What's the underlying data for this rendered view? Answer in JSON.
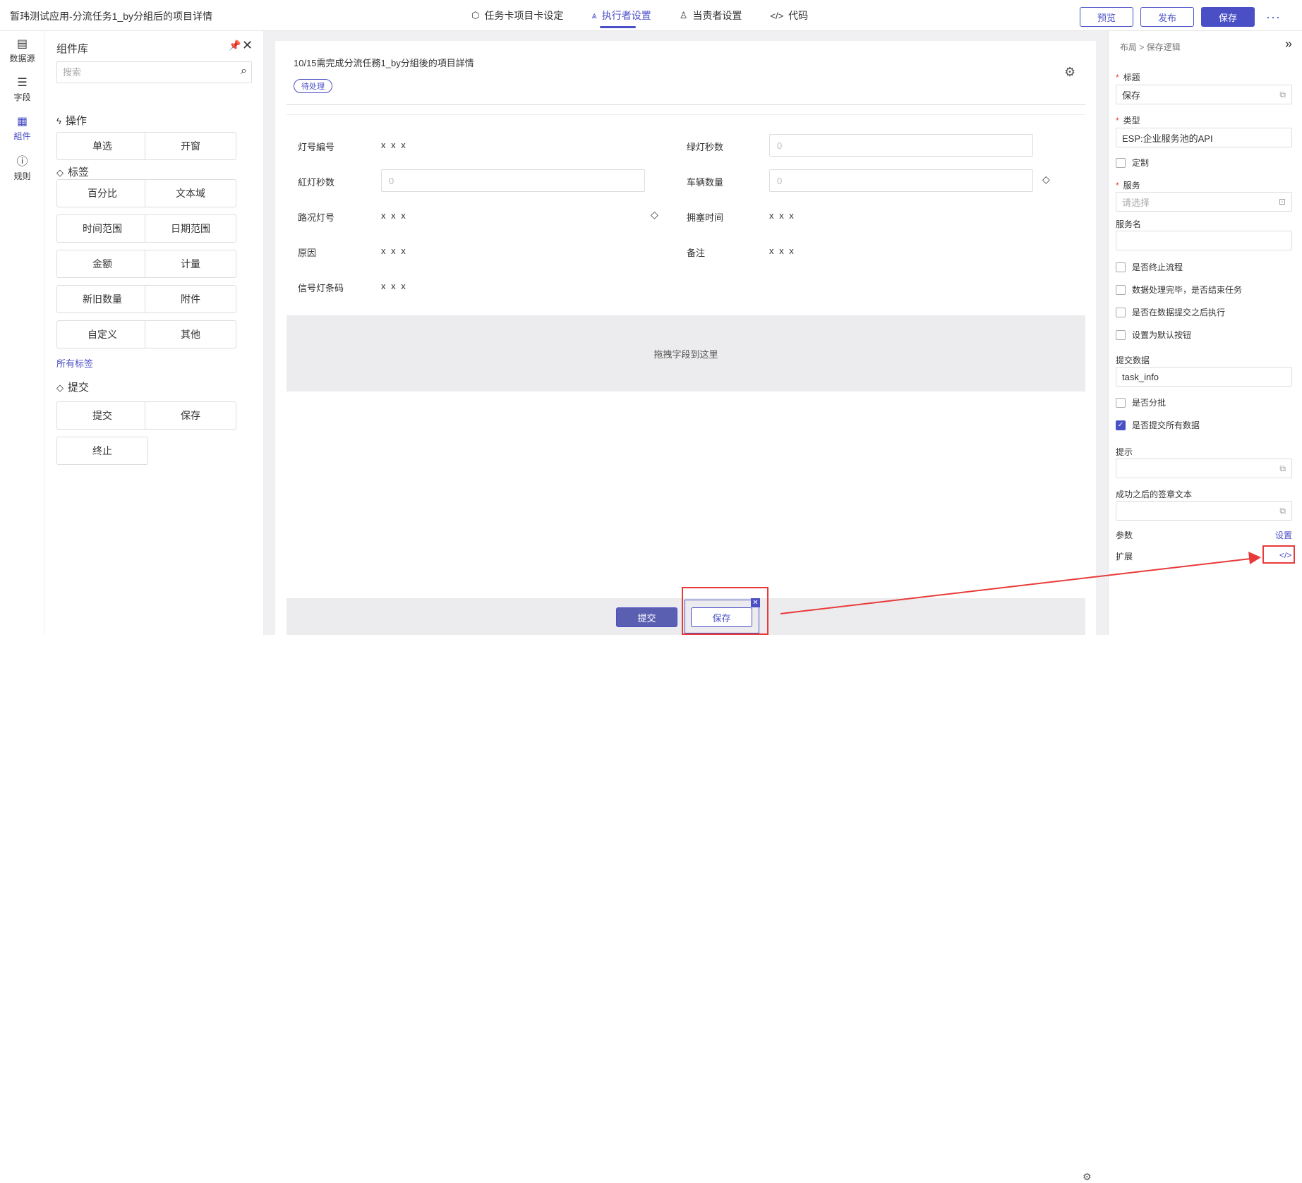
{
  "app": {
    "title": "暂玮测试应用-分流任务1_by分組后的项目详情"
  },
  "tabs": [
    {
      "label": "任务卡项目卡设定",
      "icon": "cube-icon"
    },
    {
      "label": "执行者设置",
      "icon": "executor-icon",
      "active": true
    },
    {
      "label": "当责者设置",
      "icon": "user-icon"
    },
    {
      "label": "代码",
      "icon": "code-icon"
    }
  ],
  "actions": {
    "preview": "预览",
    "publish": "发布",
    "save": "保存",
    "more": "···"
  },
  "leftnav": [
    {
      "label": "数据源",
      "icon": "datasource-icon"
    },
    {
      "label": "字段",
      "icon": "list-icon"
    },
    {
      "label": "組件",
      "icon": "grid-icon",
      "active": true
    },
    {
      "label": "规则",
      "icon": "alert-icon"
    }
  ],
  "component_panel": {
    "title": "组件库",
    "search_placeholder": "搜索",
    "sections": {
      "operation": {
        "label": "操作",
        "items": [
          "单选",
          "开窗"
        ]
      },
      "tags": {
        "label": "标签",
        "items": [
          "百分比",
          "文本域",
          "时间范围",
          "日期范围",
          "金额",
          "计量",
          "新旧数量",
          "附件",
          "自定义",
          "其他"
        ]
      },
      "all_tags": "所有标签",
      "submit": {
        "label": "提交",
        "items": [
          "提交",
          "保存",
          "终止"
        ]
      }
    }
  },
  "canvas": {
    "title": "10/15需完成分流任務1_by分組後的項目詳情",
    "badge": "待处理",
    "fields": [
      {
        "label": "灯号編号",
        "value": "x x x"
      },
      {
        "label": "绿灯秒数",
        "placeholder": "0"
      },
      {
        "label": "紅灯秒数",
        "placeholder": "0"
      },
      {
        "label": "车辆数量",
        "placeholder": "0"
      },
      {
        "label": "路况灯号",
        "value": "x x x"
      },
      {
        "label": "拥塞时间",
        "value": "x x x"
      },
      {
        "label": "原因",
        "value": "x x x"
      },
      {
        "label": "备注",
        "value": "x x x"
      },
      {
        "label": "信号灯条码",
        "value": "x x x"
      }
    ],
    "dropzone": "拖拽字段到这里",
    "footer": {
      "submit": "提交",
      "save": "保存"
    }
  },
  "right_panel": {
    "breadcrumb": "布局 > 保存逻辑",
    "title_label": "标题",
    "title_value": "保存",
    "type_label": "类型",
    "type_value": "ESP:企业服务池的API",
    "custom_label": "定制",
    "service_label": "服务",
    "service_placeholder": "请选择",
    "service_name_label": "服务名",
    "checks": [
      {
        "label": "是否终止流程",
        "checked": false
      },
      {
        "label": "数据处理完毕，是否结束任务",
        "checked": false
      },
      {
        "label": "是否在数据提交之后执行",
        "checked": false
      },
      {
        "label": "设置为默认按钮",
        "checked": false
      }
    ],
    "submit_data_label": "提交数据",
    "submit_data_value": "task_info",
    "batch_label": "是否分批",
    "submit_all_label": "是否提交所有数据",
    "submit_all_checked": true,
    "hint_label": "提示",
    "success_label": "成功之后的签章文本",
    "params_label": "参数",
    "params_link": "设置",
    "extend_label": "扩展",
    "extend_icon": "</>"
  },
  "annotation_color": "#e83a3a",
  "accent": "#4b4fc6"
}
